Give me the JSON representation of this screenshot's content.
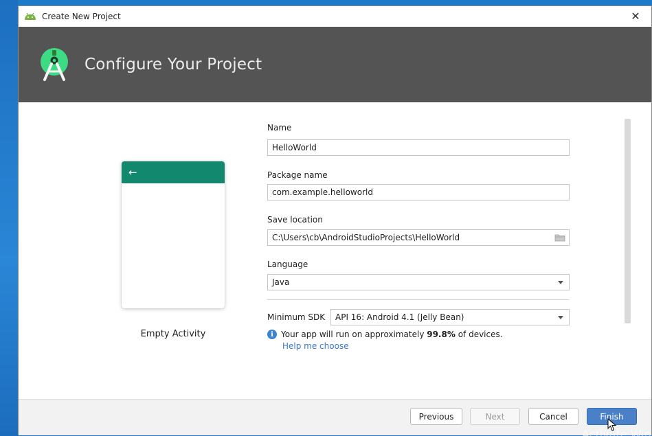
{
  "window": {
    "title": "Create New Project"
  },
  "banner": {
    "title": "Configure Your Project"
  },
  "template": {
    "caption": "Empty Activity"
  },
  "form": {
    "name": {
      "label": "Name",
      "value": "HelloWorld"
    },
    "package": {
      "label": "Package name",
      "value": "com.example.helloworld"
    },
    "location": {
      "label": "Save location",
      "value": "C:\\Users\\cb\\AndroidStudioProjects\\HelloWorld"
    },
    "language": {
      "label": "Language",
      "value": "Java"
    },
    "min_sdk": {
      "label": "Minimum SDK",
      "value": "API 16: Android 4.1 (Jelly Bean)"
    },
    "info": {
      "prefix": "Your app will run on approximately ",
      "percent": "99.8%",
      "suffix": " of devices."
    },
    "help_link": "Help me choose"
  },
  "buttons": {
    "previous": "Previous",
    "next": "Next",
    "cancel": "Cancel",
    "finish": "Finish"
  },
  "watermark": "Activate Windows",
  "colors": {
    "banner_bg": "#545454",
    "accent_green": "#12896f",
    "primary_button": "#4a80c8",
    "link": "#3b78c9"
  },
  "icons": {
    "titlebar": "android-icon",
    "banner": "android-studio-icon",
    "location": "folder-icon",
    "info": "info-icon"
  }
}
